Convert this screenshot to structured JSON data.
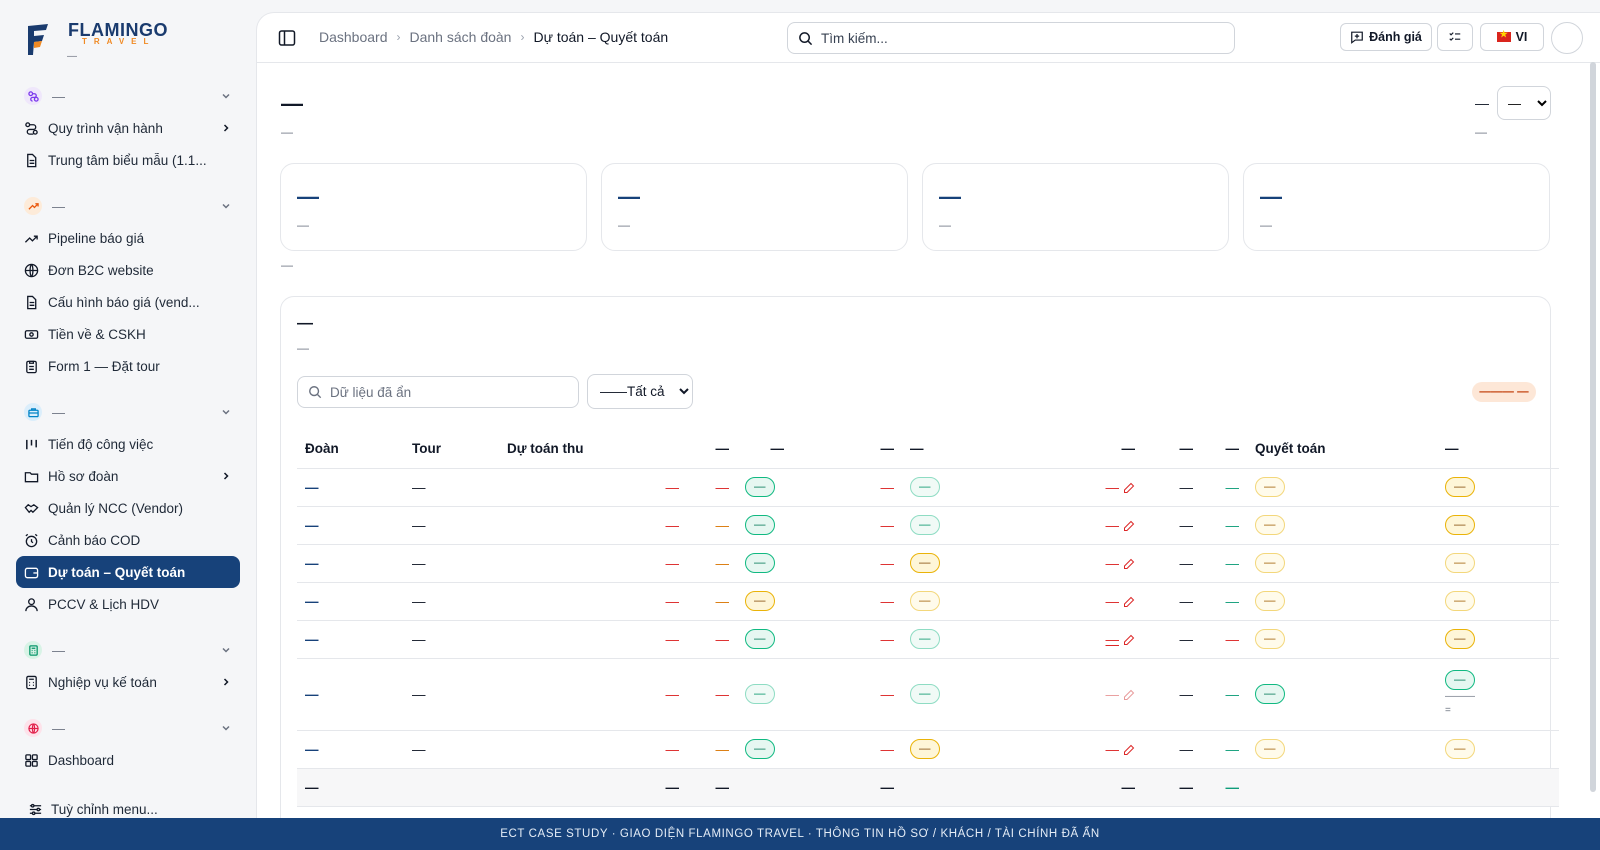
{
  "brand": {
    "word": "FLAMINGO",
    "sub": "TRAVEL",
    "tag": "—"
  },
  "sidebar": {
    "groups": [
      {
        "title": "—",
        "items": [
          {
            "label": "Quy trình vận hành"
          },
          {
            "label": "Trung tâm biểu mẫu (1.1..."
          }
        ]
      },
      {
        "title": "—",
        "items": [
          {
            "label": "Pipeline báo giá"
          },
          {
            "label": "Đơn B2C website"
          },
          {
            "label": "Cấu hình báo giá (vend..."
          },
          {
            "label": "Tiền về & CSKH"
          },
          {
            "label": "Form 1 — Đặt tour"
          }
        ]
      },
      {
        "title": "—",
        "items": [
          {
            "label": "Tiến độ công việc"
          },
          {
            "label": "Hồ sơ đoàn"
          },
          {
            "label": "Quản lý NCC (Vendor)"
          },
          {
            "label": "Cảnh báo COD"
          },
          {
            "label": "Dự toán – Quyết toán"
          },
          {
            "label": "PCCV & Lịch HDV"
          }
        ]
      },
      {
        "title": "—",
        "items": [
          {
            "label": "Nghiệp vụ kế toán"
          }
        ]
      },
      {
        "title": "—",
        "items": [
          {
            "label": "Dashboard"
          }
        ]
      }
    ],
    "customize_label": "Tuỳ chỉnh menu..."
  },
  "topbar": {
    "breadcrumbs": [
      "Dashboard",
      "Danh sách đoàn",
      "Dự toán – Quyết toán"
    ],
    "search_placeholder": "Tìm kiếm...",
    "rate_label": "Đánh giá",
    "lang_label": "VI"
  },
  "page": {
    "title": "—",
    "subtitle": "—",
    "filter_label": "—",
    "filter_sub": "—",
    "period_selected": "—"
  },
  "stats": [
    {
      "value": "—",
      "label": "—"
    },
    {
      "value": "—",
      "label": "—"
    },
    {
      "value": "—",
      "label": "—"
    },
    {
      "value": "—",
      "label": "—"
    }
  ],
  "stats_note": "—",
  "table_card": {
    "title": "—",
    "subtitle": "—",
    "search_placeholder": "Dữ liệu đã ẩn",
    "filter_selected": "——Tất cả",
    "count_pill": "——— —",
    "headers": [
      "Đoàn",
      "Tour",
      "Dự toán thu",
      "—",
      "—",
      "—",
      "—",
      "—",
      "—",
      "—",
      "Quyết toán",
      "—"
    ],
    "rows": [
      {
        "doan": "—",
        "tour": "—",
        "c1": "—",
        "c2": "—",
        "t1": "—",
        "c3": "—",
        "t2": "—",
        "c4": "—",
        "c5": "—",
        "c6": "—",
        "t3": "—",
        "t4": "—"
      },
      {
        "doan": "—",
        "tour": "—",
        "c1": "—",
        "c2": "—",
        "t1": "—",
        "c3": "—",
        "t2": "—",
        "c4": "—",
        "c5": "—",
        "c6": "—",
        "t3": "—",
        "t4": "—"
      },
      {
        "doan": "—",
        "tour": "—",
        "c1": "—",
        "c2": "—",
        "t1": "—",
        "c3": "—",
        "t2": "—",
        "c4": "—",
        "c5": "—",
        "c6": "—",
        "t3": "—",
        "t4": "—"
      },
      {
        "doan": "—",
        "tour": "—",
        "c1": "—",
        "c2": "—",
        "t1": "—",
        "c3": "—",
        "t2": "—",
        "c4": "—",
        "c5": "—",
        "c6": "—",
        "t3": "—",
        "t4": "—"
      },
      {
        "doan": "—",
        "tour": "—",
        "c1": "—",
        "c2": "—",
        "t1": "—",
        "c3": "—",
        "t2": "—",
        "c4": "—",
        "c5": "—",
        "c6": "—",
        "t3": "—",
        "t4": "—"
      },
      {
        "doan": "—",
        "tour": "—",
        "c1": "—",
        "c2": "—",
        "t1": "—",
        "c3": "—",
        "t2": "—",
        "c4": "—",
        "c5": "—",
        "c6": "—",
        "t3": "—",
        "t4": "—",
        "t4_extra1": "———",
        "t4_extra2": "="
      },
      {
        "doan": "—",
        "tour": "—",
        "c1": "—",
        "c2": "—",
        "t1": "—",
        "c3": "—",
        "t2": "—",
        "c4": "—",
        "c5": "—",
        "c6": "—",
        "t3": "—",
        "t4": "—"
      }
    ],
    "totals": {
      "doan": "—",
      "c1": "—",
      "c2": "—",
      "c3": "—",
      "c4": "—",
      "c5": "—",
      "c6": "—"
    }
  },
  "footer_text": "ECT CASE STUDY · GIAO DIỆN FLAMINGO TRAVEL · THÔNG TIN HỒ SƠ / KHÁCH / TÀI CHÍNH ĐÃ ẨN",
  "colors": {
    "brand_navy": "#17427a",
    "accent_orange": "#f08a24",
    "danger": "#dc2626",
    "success": "#10b981",
    "warning": "#eab308"
  }
}
